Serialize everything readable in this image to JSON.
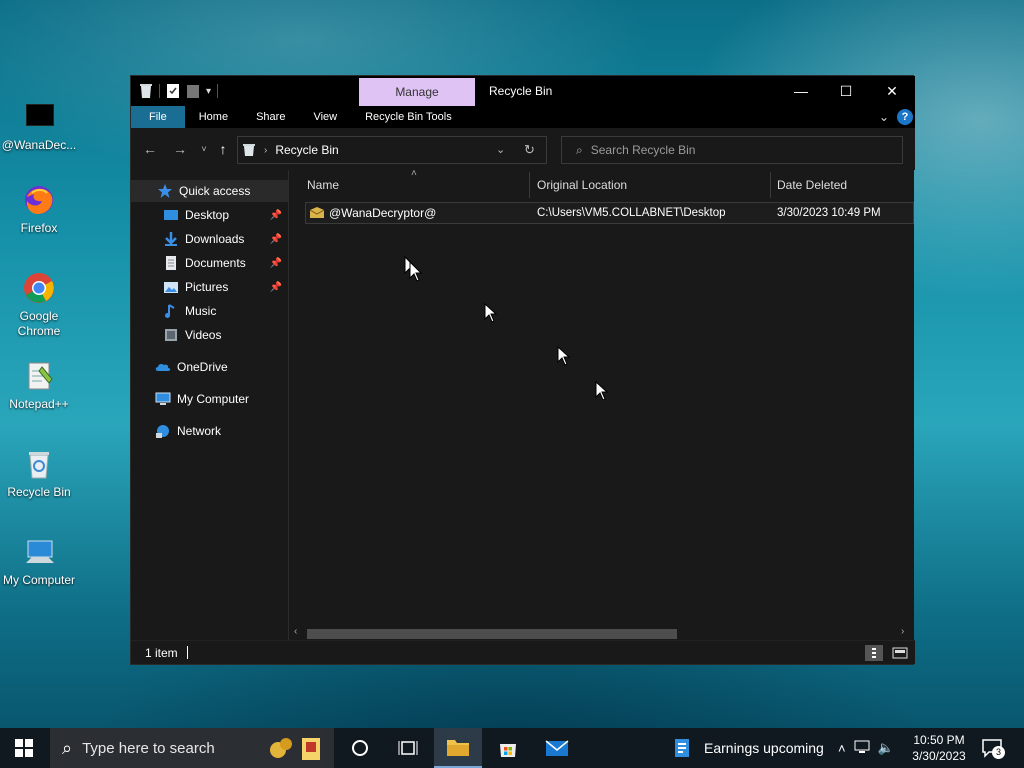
{
  "desktop": {
    "icons": [
      {
        "label": "@WanaDec...",
        "icon": "wana-decryptor-icon"
      },
      {
        "label": "Firefox",
        "icon": "firefox-icon"
      },
      {
        "label": "Google Chrome",
        "icon": "chrome-icon"
      },
      {
        "label": "Notepad++",
        "icon": "notepadpp-icon"
      },
      {
        "label": "Recycle Bin",
        "icon": "recycle-bin-icon"
      },
      {
        "label": "My Computer",
        "icon": "computer-icon"
      }
    ]
  },
  "window": {
    "title": "Recycle Bin",
    "manage_tab": "Manage",
    "controls": {
      "minimize": "—",
      "maximize": "☐",
      "close": "✕"
    },
    "ribbon_tabs": [
      "File",
      "Home",
      "Share",
      "View",
      "Recycle Bin Tools"
    ],
    "address_path": "Recycle Bin",
    "search_placeholder": "Search Recycle Bin",
    "nav": {
      "quick_access": "Quick access",
      "items": [
        {
          "label": "Desktop",
          "pinned": true
        },
        {
          "label": "Downloads",
          "pinned": true
        },
        {
          "label": "Documents",
          "pinned": true
        },
        {
          "label": "Pictures",
          "pinned": true
        },
        {
          "label": "Music",
          "pinned": false
        },
        {
          "label": "Videos",
          "pinned": false
        }
      ],
      "onedrive": "OneDrive",
      "my_computer": "My Computer",
      "network": "Network"
    },
    "columns": [
      "Name",
      "Original Location",
      "Date Deleted"
    ],
    "files": [
      {
        "name": "@WanaDecryptor@",
        "original_location": "C:\\Users\\VM5.COLLABNET\\Desktop",
        "date_deleted": "3/30/2023 10:49 PM"
      }
    ],
    "status": "1 item"
  },
  "taskbar": {
    "search_placeholder": "Type here to search",
    "news": "Earnings upcoming",
    "time": "10:50 PM",
    "date": "3/30/2023",
    "notification_count": "3"
  },
  "colors": {
    "file_tab": "#1a6e93",
    "manage_tab": "#e0c3f5",
    "window_bg": "#191919",
    "taskbar_bg": "#101820"
  }
}
